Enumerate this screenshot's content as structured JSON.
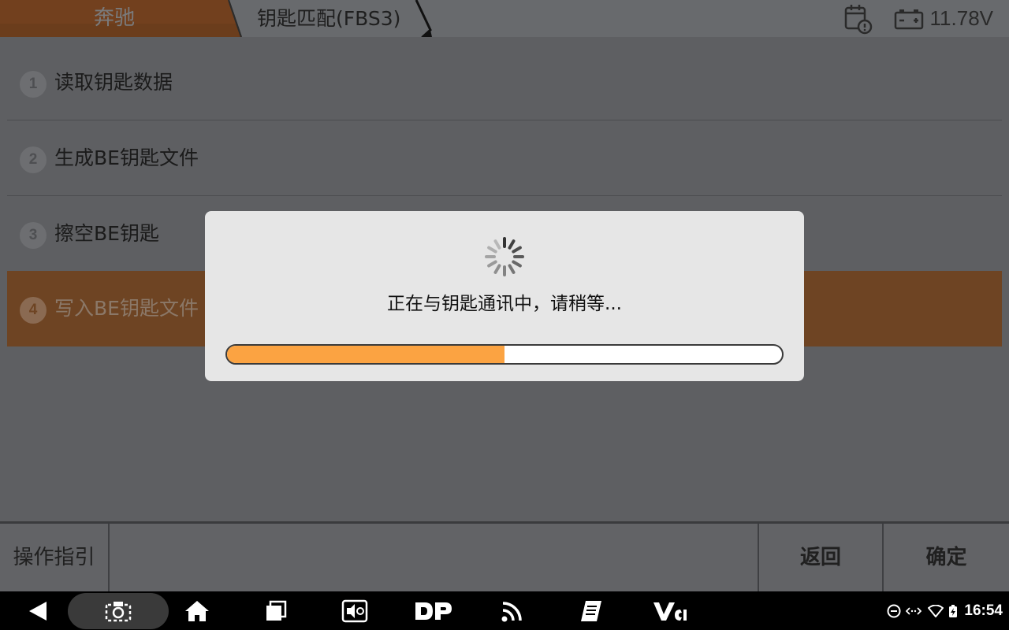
{
  "header": {
    "brand": "奔驰",
    "page_title": "钥匙匹配(FBS3)",
    "calendar_icon": "calendar-clock-icon",
    "battery_icon": "car-battery-icon",
    "voltage": "11.78V"
  },
  "menu": {
    "items": [
      {
        "num": "1",
        "label": "读取钥匙数据"
      },
      {
        "num": "2",
        "label": "生成BE钥匙文件"
      },
      {
        "num": "3",
        "label": "擦空BE钥匙"
      },
      {
        "num": "4",
        "label": "写入BE钥匙文件",
        "selected": true
      }
    ]
  },
  "dialog": {
    "spinner_icon": "loading-spinner-icon",
    "message": "正在与钥匙通讯中，请稍等...",
    "progress": 0.5
  },
  "bottom_bar": {
    "guide_label": "操作指引",
    "back_label": "返回",
    "confirm_label": "确定"
  },
  "navbar": {
    "icons": [
      "back-icon",
      "screenshot-icon",
      "home-icon",
      "recent-apps-icon",
      "screen-brightness-icon",
      "dp-icon",
      "vci-signal-icon",
      "notes-icon",
      "vci-icon"
    ],
    "status_time": "16:54"
  },
  "colors": {
    "brand_orange": "#b0652b",
    "selected_row": "#6e4423",
    "progress_fill": "#fba342"
  }
}
